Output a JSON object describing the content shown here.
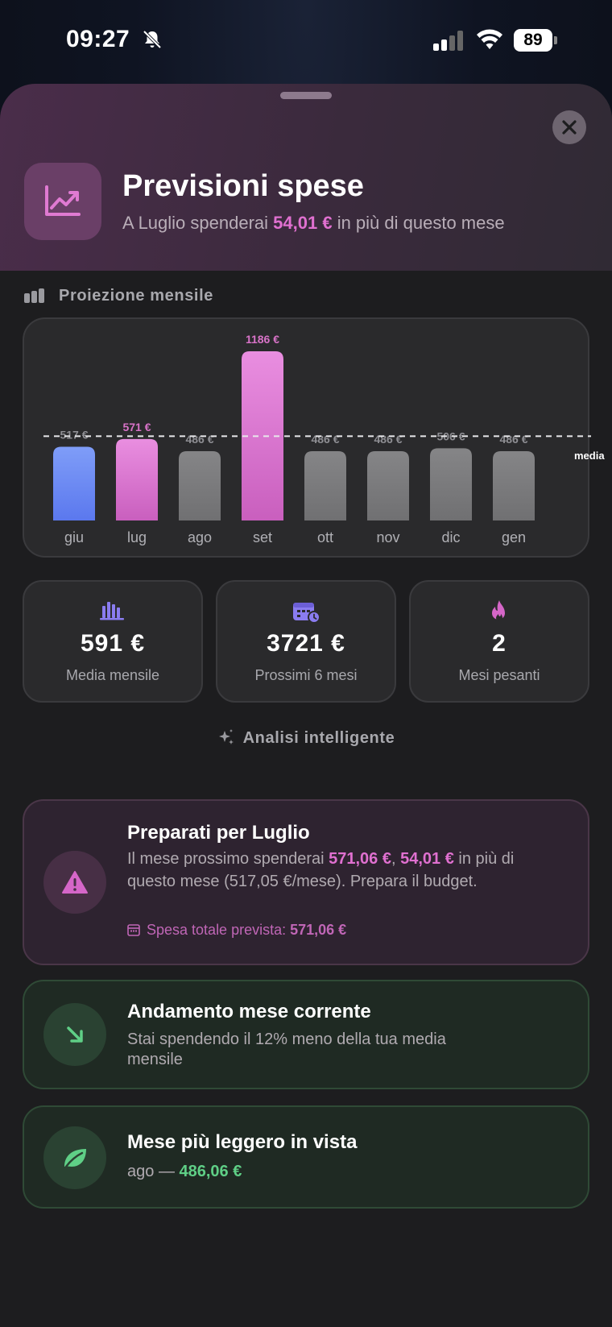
{
  "status_bar": {
    "time": "09:27",
    "battery": "89"
  },
  "header": {
    "title": "Previsioni spese",
    "subtitle_pre": "A Luglio spenderai",
    "subtitle_amount": "54,01 €",
    "subtitle_post": "in più di questo mese"
  },
  "projection": {
    "section_label": "Proiezione mensile",
    "average_label": "media"
  },
  "chart_data": {
    "type": "bar",
    "categories": [
      "giu",
      "lug",
      "ago",
      "set",
      "ott",
      "nov",
      "dic",
      "gen"
    ],
    "values": [
      517,
      571,
      486,
      1186,
      486,
      486,
      506,
      486
    ],
    "value_labels": [
      "517 €",
      "571 €",
      "486 €",
      "1186 €",
      "486 €",
      "486 €",
      "506 €",
      "486 €"
    ],
    "average": 591,
    "bar_styles": [
      "current",
      "highlight",
      "normal",
      "highlight",
      "normal",
      "normal",
      "normal",
      "normal"
    ],
    "ylim": [
      0,
      1186
    ],
    "colors": {
      "current": "#6e8ef5",
      "highlight": "#d566c8",
      "normal": "#7a7a7c",
      "highlight_label": "#d873c8",
      "label": "#8e8e93"
    }
  },
  "stats": [
    {
      "icon": "bar-chart-icon",
      "value": "591 €",
      "label": "Media mensile"
    },
    {
      "icon": "calendar-clock-icon",
      "value": "3721 €",
      "label": "Prossimi 6 mesi"
    },
    {
      "icon": "flame-icon",
      "value": "2",
      "label": "Mesi pesanti"
    }
  ],
  "analysis": {
    "section_label": "Analisi intelligente",
    "prepare": {
      "title": "Preparati per Luglio",
      "body_pre": "Il mese prossimo spenderai",
      "amount1": "571,06 €",
      "sep": ",",
      "amount2": "54,01 €",
      "body_post": "in più di questo mese (517,05 €/mese). Prepara il budget.",
      "foot_pre": "Spesa totale prevista:",
      "foot_amount": "571,06 €"
    },
    "trend": {
      "title": "Andamento mese corrente",
      "body": "Stai spendendo il 12% meno della tua media mensile"
    },
    "lighter": {
      "title": "Mese più leggero in vista",
      "month": "ago",
      "dash": "—",
      "amount": "486,06 €"
    }
  },
  "colors": {
    "accent_pink": "#e070d0",
    "accent_green": "#5fcf86",
    "accent_blue": "#6e8ef5",
    "accent_purple": "#8a7cf0"
  }
}
